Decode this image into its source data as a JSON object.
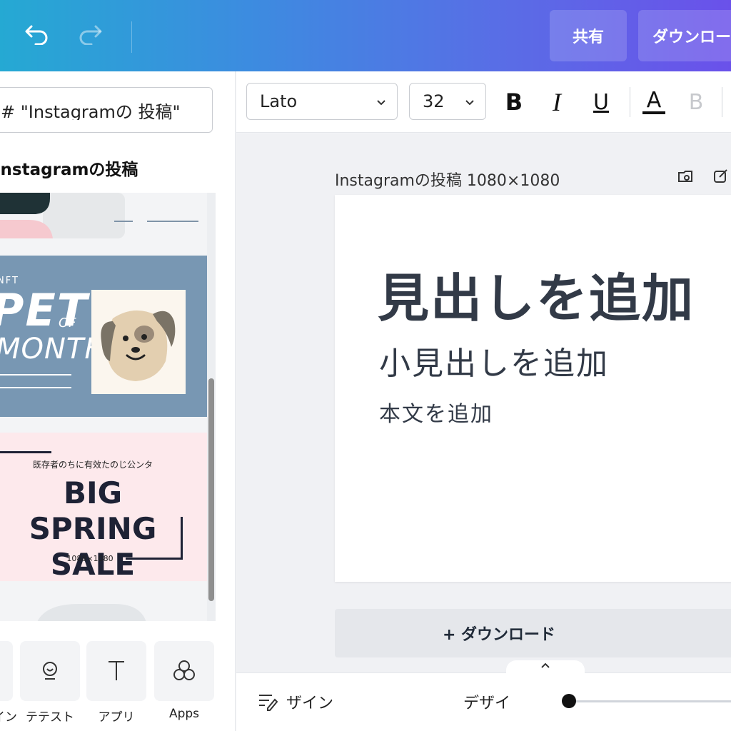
{
  "topbar": {
    "undo_icon": "undo-icon",
    "redo_icon": "redo-icon",
    "share_label": "共有",
    "download_label": "ダウンロード"
  },
  "left_panel": {
    "search_value": "# \"Instagramの 投稿\"",
    "section_title": "Instagramの投稿",
    "templates": {
      "nft": {
        "small": "NFT",
        "big": "PET",
        "of": "OF",
        "month": "MONTH"
      },
      "spring": {
        "small": "既存者のちに有效たのじ公ンタ",
        "line1": "BIG SPRING",
        "line2": "SALE",
        "size": "1088×1080"
      }
    },
    "tools": [
      {
        "label": "デザイン",
        "icon": "layout-icon"
      },
      {
        "label": "テテスト",
        "icon": "elements-icon"
      },
      {
        "label": "アプリ",
        "icon": "text-icon"
      },
      {
        "label": "Apps",
        "icon": "apps-icon"
      }
    ]
  },
  "format_bar": {
    "font": "Lato",
    "size": "32",
    "bold": "B",
    "italic": "I",
    "underline": "U",
    "color": "A",
    "disabled_bold": "B"
  },
  "canvas": {
    "design_label": "Instagramの投稿 1080×1080",
    "heading": "見出しを追加",
    "subheading": "小見出しを追加",
    "body": "本文を追加",
    "add_page_label": "+ ダウンロード"
  },
  "bottom_bar": {
    "notes_label": "ザイン",
    "design_label": "デザイ"
  },
  "colors": {
    "accent_gradient_start": "#25a9d3",
    "accent_gradient_end": "#6a51ea",
    "text_dark": "#323a47"
  }
}
